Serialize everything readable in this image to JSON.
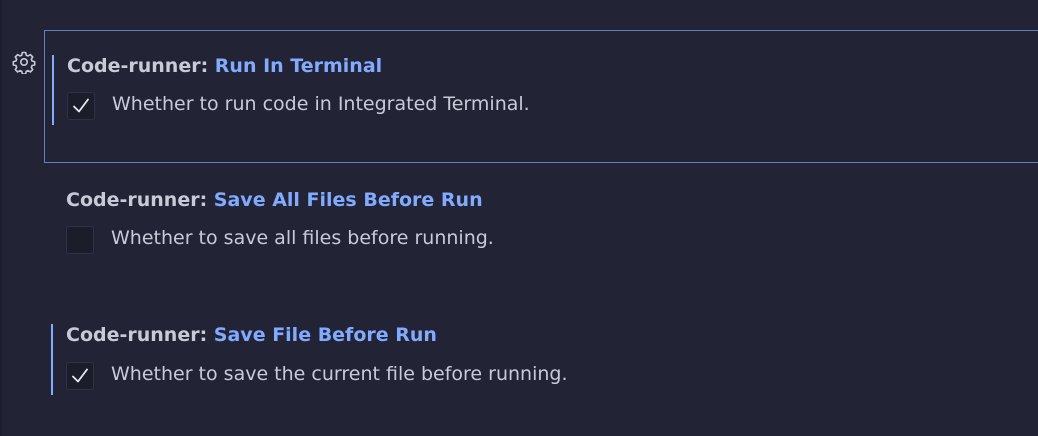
{
  "settings": [
    {
      "category": "Code-runner: ",
      "name": "Run In Terminal",
      "checked": true,
      "description": "Whether to run code in Integrated Terminal."
    },
    {
      "category": "Code-runner: ",
      "name": "Save All Files Before Run",
      "checked": false,
      "description": "Whether to save all files before running."
    },
    {
      "category": "Code-runner: ",
      "name": "Save File Before Run",
      "checked": true,
      "description": "Whether to save the current file before running."
    }
  ],
  "colors": {
    "background": "#222436",
    "accent": "#82aaff",
    "text": "#c8cad8",
    "focus_border": "#5f7fbf"
  },
  "icons": {
    "settings_gear": "gear-icon",
    "checkmark": "check-icon"
  }
}
